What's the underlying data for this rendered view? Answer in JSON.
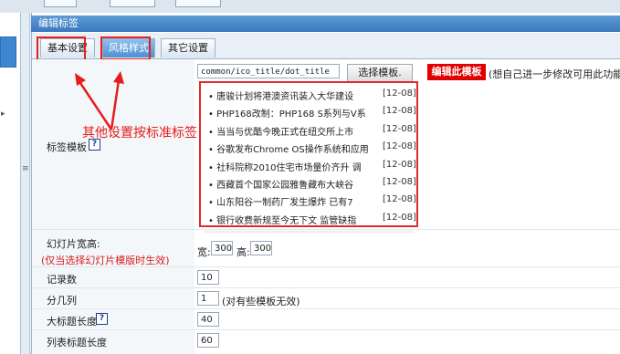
{
  "panel": {
    "title": "编辑标签"
  },
  "tabs": [
    {
      "label": "基本设置"
    },
    {
      "label": "风格样式"
    },
    {
      "label": "其它设置"
    }
  ],
  "template": {
    "label": "标签模板",
    "help_mark": "?",
    "path_value": "common/ico_title/dot_title",
    "select_button": "选择模板.",
    "edit_button": "编辑此模板",
    "edit_note": "(想自己进一步修改可用此功能)"
  },
  "preview": {
    "items": [
      {
        "title": "唐骏计划将港澳资讯装入大华建设",
        "date": "[12-08]"
      },
      {
        "title": "PHP168改制：PHP168 S系列与V系",
        "date": "[12-08]"
      },
      {
        "title": "当当与优酷今晚正式在纽交所上市",
        "date": "[12-08]"
      },
      {
        "title": "谷歌发布Chrome OS操作系统和应用",
        "date": "[12-08]"
      },
      {
        "title": "社科院称2010住宅市场量价齐升 调",
        "date": "[12-08]"
      },
      {
        "title": "西藏首个国家公园雅鲁藏布大峡谷",
        "date": "[12-08]"
      },
      {
        "title": "山东阳谷一制药厂发生爆炸 已有7",
        "date": "[12-08]"
      },
      {
        "title": "银行收费新规至今无下文 监管缺指",
        "date": "[12-08]"
      }
    ]
  },
  "annotation": {
    "text": "其他设置按标准标签"
  },
  "slideshow": {
    "label": "幻灯片宽高:",
    "note": "(仅当选择幻灯片模版时生效)",
    "width_label": "宽:",
    "width_value": "300",
    "height_label": "高:",
    "height_value": "300"
  },
  "rows": {
    "record_count": {
      "label": "记录数",
      "value": "10"
    },
    "columns": {
      "label": "分几列",
      "value": "1",
      "note": "(对有些模板无效)"
    },
    "headline_length": {
      "label": "大标题长度",
      "help_mark": "?",
      "value": "40"
    },
    "list_title_length": {
      "label": "列表标题长度",
      "value": "60"
    }
  },
  "colors": {
    "header": "#3a78bd",
    "accent_red": "#e10000",
    "annotation": "#e51c1c"
  }
}
